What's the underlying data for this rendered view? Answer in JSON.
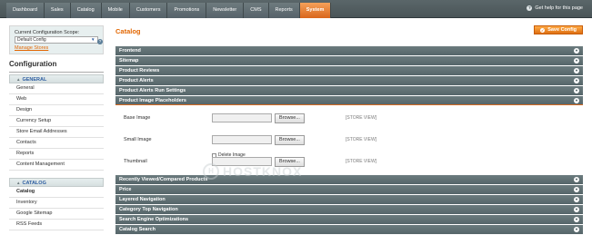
{
  "nav": {
    "items": [
      "Dashboard",
      "Sales",
      "Catalog",
      "Mobile",
      "Customers",
      "Promotions",
      "Newsletter",
      "CMS",
      "Reports",
      "System"
    ],
    "active": "System",
    "help": "Get help for this page"
  },
  "sidebar": {
    "scope_label": "Current Configuration Scope:",
    "scope_value": "Default Config",
    "manage_stores": "Manage Stores",
    "heading": "Configuration",
    "sections": [
      {
        "title": "GENERAL",
        "items": [
          "General",
          "Web",
          "Design",
          "Currency Setup",
          "Store Email Addresses",
          "Contacts",
          "Reports",
          "Content Management"
        ]
      },
      {
        "title": "CATALOG",
        "items": [
          "Catalog",
          "Inventory",
          "Google Sitemap",
          "RSS Feeds"
        ]
      }
    ],
    "active_item": "Catalog"
  },
  "main": {
    "title": "Catalog",
    "save_label": "Save Config",
    "groups_top": [
      "Frontend",
      "Sitemap",
      "Product Reviews",
      "Product Alerts",
      "Product Alerts Run Settings"
    ],
    "open_group": "Product Image Placeholders",
    "fields": [
      {
        "label": "Base Image",
        "button": "Browse...",
        "scope": "[STORE VIEW]"
      },
      {
        "label": "Small Image",
        "button": "Browse...",
        "scope": "[STORE VIEW]"
      },
      {
        "label": "Thumbnail",
        "button": "Browse...",
        "scope": "[STORE VIEW]"
      }
    ],
    "delete_label": "Delete Image",
    "groups_bottom": [
      "Recently Viewed/Compared Products",
      "Price",
      "Layered Navigation",
      "Category Top Navigation",
      "Search Engine Optimizations",
      "Catalog Search"
    ]
  },
  "watermark": {
    "logo": "H",
    "text": "HOSTKNOX"
  },
  "colors": {
    "accent": "#e26703",
    "header": "#56666a",
    "nav": "#4a5558",
    "link": "#2d5da0"
  }
}
